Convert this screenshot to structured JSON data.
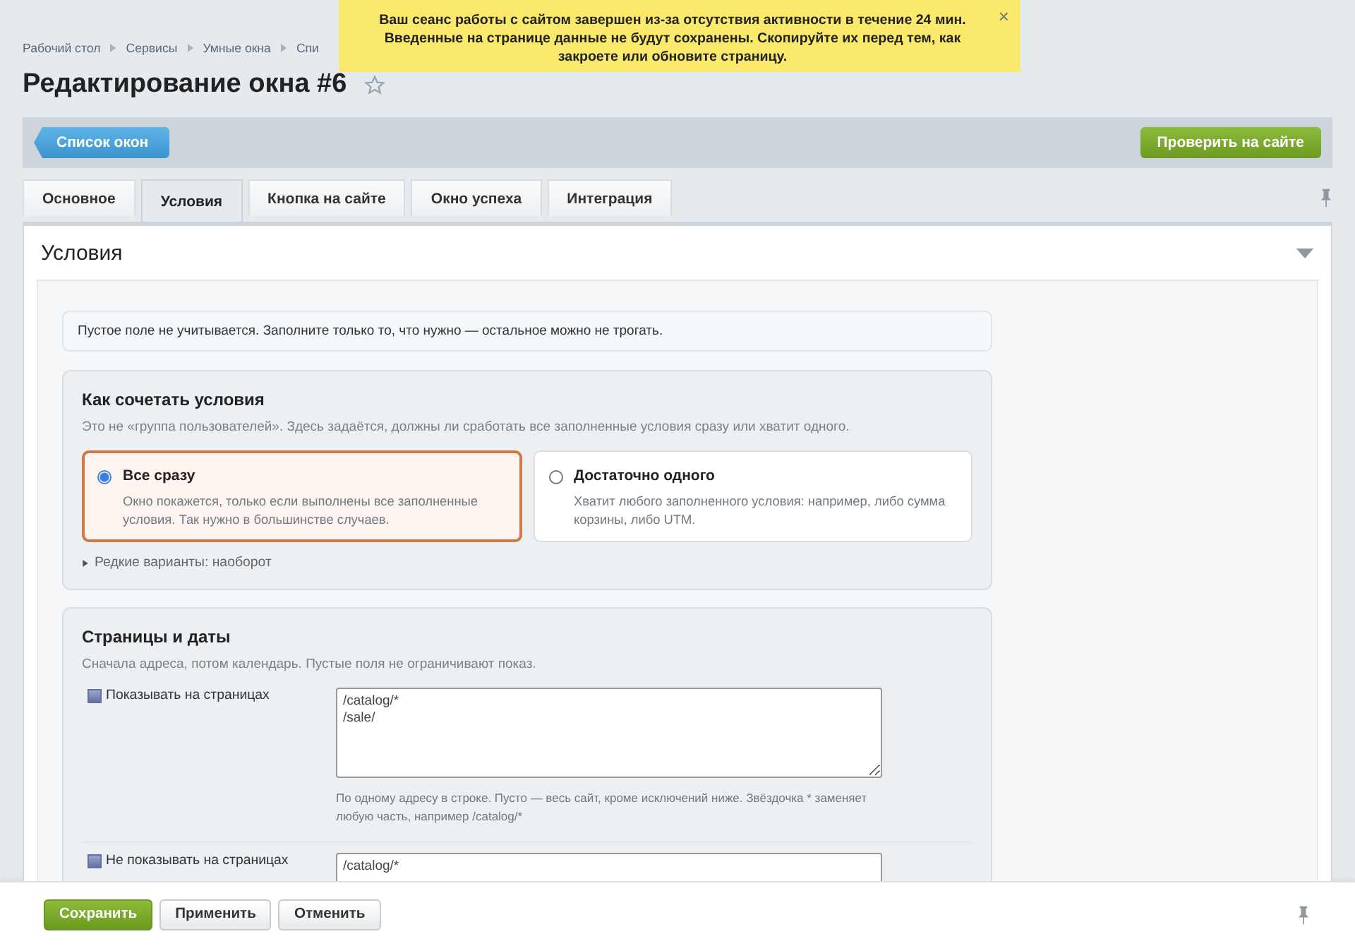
{
  "breadcrumbs": [
    "Рабочий стол",
    "Сервисы",
    "Умные окна",
    "Спи"
  ],
  "notification": {
    "lines": [
      "Ваш сеанс работы с сайтом завершен из-за отсутствия активности в течение 24 мин.",
      "Введенные на странице данные не будут сохранены. Скопируйте их перед тем, как закроете или обновите страницу."
    ],
    "close": "×"
  },
  "title": "Редактирование окна #6",
  "favorite": false,
  "toolbar": {
    "back_button": "Список окон",
    "action_button": "Проверить на сайте"
  },
  "tabs": [
    {
      "label": "Основное",
      "selected": false
    },
    {
      "label": "Условия",
      "selected": true
    },
    {
      "label": "Кнопка на сайте",
      "selected": false
    },
    {
      "label": "Окно успеха",
      "selected": false
    },
    {
      "label": "Интеграция",
      "selected": false
    }
  ],
  "section": {
    "title": "Условия",
    "expanded": true,
    "hint": "Пустое поле не учитывается. Заполните только то, что нужно — остальное можно не трогать.",
    "combine": {
      "title": "Как сочетать условия",
      "description": "Это не «группа пользователей». Здесь задаётся, должны ли сработать все заполненные условия сразу или хватит одного.",
      "options": [
        {
          "label": "Все сразу",
          "description": "Окно покажется, только если выполнены все заполненные условия. Так нужно в большинстве случаев.",
          "selected": true
        },
        {
          "label": "Достаточно одного",
          "description": "Хватит любого заполненного условия: например, либо сумма корзины, либо UTM.",
          "selected": false
        }
      ],
      "more": "Редкие варианты: наоборот",
      "more_expanded": false
    },
    "pages": {
      "title": "Страницы и даты",
      "description": "Сначала адреса, потом календарь. Пустые поля не ограничивают показ.",
      "fields": [
        {
          "label": "Показывать на страницах",
          "value": "/catalog/*\n/sale/",
          "help": "По одному адресу в строке. Пусто — весь сайт, кроме исключений ниже. Звёздочка * заменяет любую часть, например /catalog/*"
        },
        {
          "label": "Не показывать на страницах",
          "value": "/catalog/*"
        }
      ]
    }
  },
  "footer": {
    "buttons": [
      {
        "label": "Сохранить",
        "kind": "primary"
      },
      {
        "label": "Применить",
        "kind": "secondary"
      },
      {
        "label": "Отменить",
        "kind": "secondary"
      }
    ]
  }
}
